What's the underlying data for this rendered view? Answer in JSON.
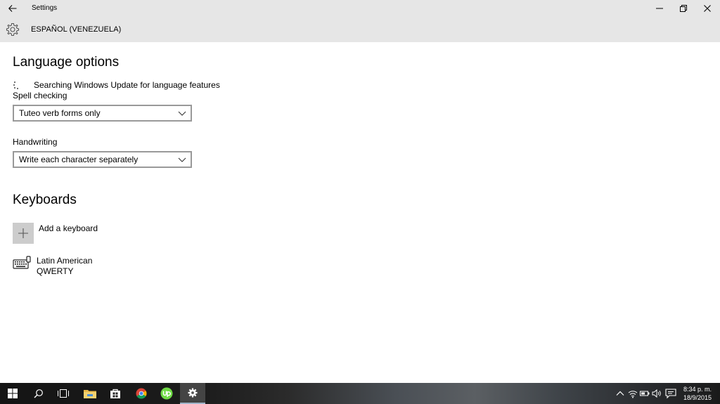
{
  "window": {
    "title": "Settings",
    "header": "ESPAÑOL (VENEZUELA)"
  },
  "language_options": {
    "heading": "Language options",
    "status": "Searching Windows Update for language features",
    "spell_checking": {
      "label": "Spell checking",
      "value": "Tuteo verb forms only"
    },
    "handwriting": {
      "label": "Handwriting",
      "value": "Write each character separately"
    }
  },
  "keyboards": {
    "heading": "Keyboards",
    "add_label": "Add a keyboard",
    "items": [
      {
        "name": "Latin American",
        "layout": "QWERTY"
      }
    ]
  },
  "taskbar": {
    "time": "8:34 p. m.",
    "date": "18/9/2015",
    "apps": [
      "start-icon",
      "search-icon",
      "task-view-icon",
      "file-explorer-icon",
      "store-icon",
      "chrome-icon",
      "upwork-icon",
      "settings-icon"
    ],
    "tray": [
      "chevron-up-icon",
      "wifi-icon",
      "battery-icon",
      "volume-icon",
      "notification-icon"
    ]
  },
  "colors": {
    "titlebar_bg": "#e6e6e6",
    "combo_border": "#999999",
    "add_tile_bg": "#cccccc"
  }
}
